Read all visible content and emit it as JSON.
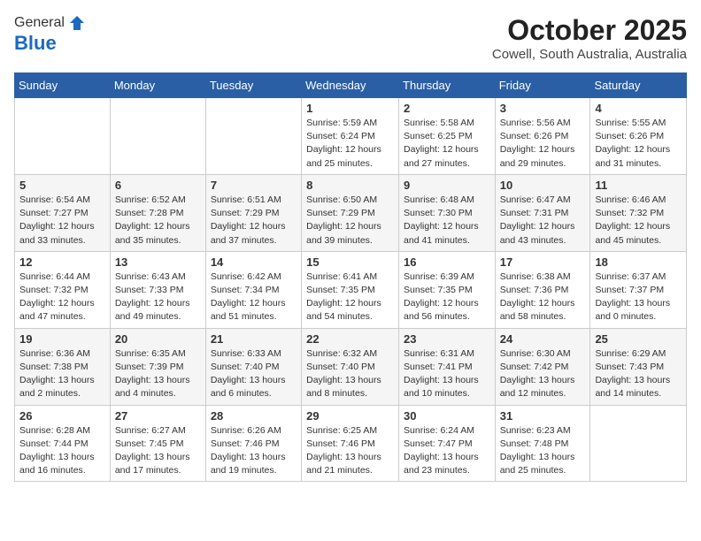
{
  "header": {
    "logo_general": "General",
    "logo_blue": "Blue",
    "month": "October 2025",
    "location": "Cowell, South Australia, Australia"
  },
  "days_of_week": [
    "Sunday",
    "Monday",
    "Tuesday",
    "Wednesday",
    "Thursday",
    "Friday",
    "Saturday"
  ],
  "weeks": [
    [
      {
        "day": "",
        "content": ""
      },
      {
        "day": "",
        "content": ""
      },
      {
        "day": "",
        "content": ""
      },
      {
        "day": "1",
        "content": "Sunrise: 5:59 AM\nSunset: 6:24 PM\nDaylight: 12 hours\nand 25 minutes."
      },
      {
        "day": "2",
        "content": "Sunrise: 5:58 AM\nSunset: 6:25 PM\nDaylight: 12 hours\nand 27 minutes."
      },
      {
        "day": "3",
        "content": "Sunrise: 5:56 AM\nSunset: 6:26 PM\nDaylight: 12 hours\nand 29 minutes."
      },
      {
        "day": "4",
        "content": "Sunrise: 5:55 AM\nSunset: 6:26 PM\nDaylight: 12 hours\nand 31 minutes."
      }
    ],
    [
      {
        "day": "5",
        "content": "Sunrise: 6:54 AM\nSunset: 7:27 PM\nDaylight: 12 hours\nand 33 minutes."
      },
      {
        "day": "6",
        "content": "Sunrise: 6:52 AM\nSunset: 7:28 PM\nDaylight: 12 hours\nand 35 minutes."
      },
      {
        "day": "7",
        "content": "Sunrise: 6:51 AM\nSunset: 7:29 PM\nDaylight: 12 hours\nand 37 minutes."
      },
      {
        "day": "8",
        "content": "Sunrise: 6:50 AM\nSunset: 7:29 PM\nDaylight: 12 hours\nand 39 minutes."
      },
      {
        "day": "9",
        "content": "Sunrise: 6:48 AM\nSunset: 7:30 PM\nDaylight: 12 hours\nand 41 minutes."
      },
      {
        "day": "10",
        "content": "Sunrise: 6:47 AM\nSunset: 7:31 PM\nDaylight: 12 hours\nand 43 minutes."
      },
      {
        "day": "11",
        "content": "Sunrise: 6:46 AM\nSunset: 7:32 PM\nDaylight: 12 hours\nand 45 minutes."
      }
    ],
    [
      {
        "day": "12",
        "content": "Sunrise: 6:44 AM\nSunset: 7:32 PM\nDaylight: 12 hours\nand 47 minutes."
      },
      {
        "day": "13",
        "content": "Sunrise: 6:43 AM\nSunset: 7:33 PM\nDaylight: 12 hours\nand 49 minutes."
      },
      {
        "day": "14",
        "content": "Sunrise: 6:42 AM\nSunset: 7:34 PM\nDaylight: 12 hours\nand 51 minutes."
      },
      {
        "day": "15",
        "content": "Sunrise: 6:41 AM\nSunset: 7:35 PM\nDaylight: 12 hours\nand 54 minutes."
      },
      {
        "day": "16",
        "content": "Sunrise: 6:39 AM\nSunset: 7:35 PM\nDaylight: 12 hours\nand 56 minutes."
      },
      {
        "day": "17",
        "content": "Sunrise: 6:38 AM\nSunset: 7:36 PM\nDaylight: 12 hours\nand 58 minutes."
      },
      {
        "day": "18",
        "content": "Sunrise: 6:37 AM\nSunset: 7:37 PM\nDaylight: 13 hours\nand 0 minutes."
      }
    ],
    [
      {
        "day": "19",
        "content": "Sunrise: 6:36 AM\nSunset: 7:38 PM\nDaylight: 13 hours\nand 2 minutes."
      },
      {
        "day": "20",
        "content": "Sunrise: 6:35 AM\nSunset: 7:39 PM\nDaylight: 13 hours\nand 4 minutes."
      },
      {
        "day": "21",
        "content": "Sunrise: 6:33 AM\nSunset: 7:40 PM\nDaylight: 13 hours\nand 6 minutes."
      },
      {
        "day": "22",
        "content": "Sunrise: 6:32 AM\nSunset: 7:40 PM\nDaylight: 13 hours\nand 8 minutes."
      },
      {
        "day": "23",
        "content": "Sunrise: 6:31 AM\nSunset: 7:41 PM\nDaylight: 13 hours\nand 10 minutes."
      },
      {
        "day": "24",
        "content": "Sunrise: 6:30 AM\nSunset: 7:42 PM\nDaylight: 13 hours\nand 12 minutes."
      },
      {
        "day": "25",
        "content": "Sunrise: 6:29 AM\nSunset: 7:43 PM\nDaylight: 13 hours\nand 14 minutes."
      }
    ],
    [
      {
        "day": "26",
        "content": "Sunrise: 6:28 AM\nSunset: 7:44 PM\nDaylight: 13 hours\nand 16 minutes."
      },
      {
        "day": "27",
        "content": "Sunrise: 6:27 AM\nSunset: 7:45 PM\nDaylight: 13 hours\nand 17 minutes."
      },
      {
        "day": "28",
        "content": "Sunrise: 6:26 AM\nSunset: 7:46 PM\nDaylight: 13 hours\nand 19 minutes."
      },
      {
        "day": "29",
        "content": "Sunrise: 6:25 AM\nSunset: 7:46 PM\nDaylight: 13 hours\nand 21 minutes."
      },
      {
        "day": "30",
        "content": "Sunrise: 6:24 AM\nSunset: 7:47 PM\nDaylight: 13 hours\nand 23 minutes."
      },
      {
        "day": "31",
        "content": "Sunrise: 6:23 AM\nSunset: 7:48 PM\nDaylight: 13 hours\nand 25 minutes."
      },
      {
        "day": "",
        "content": ""
      }
    ]
  ]
}
